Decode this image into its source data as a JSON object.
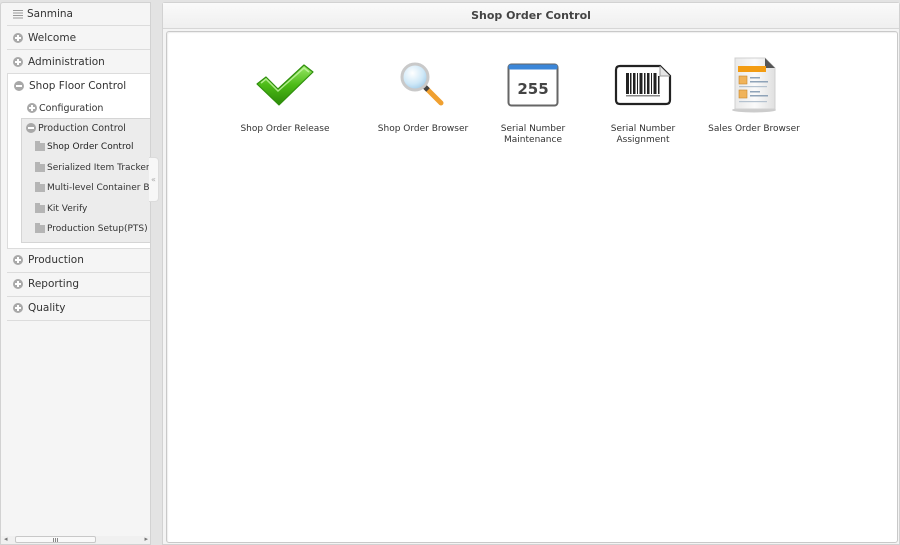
{
  "sidebar": {
    "header": "Sanmina",
    "items_top": [
      {
        "label": "Welcome",
        "icon": "plus-circle-icon"
      },
      {
        "label": "Administration",
        "icon": "plus-circle-icon"
      }
    ],
    "expanded": {
      "label": "Shop Floor Control",
      "icon": "minus-circle-icon",
      "children": [
        {
          "label": "Configuration",
          "icon": "plus-circle-icon"
        }
      ],
      "subgroup": {
        "label": "Production Control",
        "icon": "minus-circle-icon",
        "leaves": [
          {
            "label": "Shop Order Control",
            "active": true
          },
          {
            "label": "Serialized Item Tracker"
          },
          {
            "label": "Multi-level Container Browser"
          },
          {
            "label": "Kit Verify"
          },
          {
            "label": "Production Setup(PTS)"
          }
        ]
      }
    },
    "items_bottom": [
      {
        "label": "Production",
        "icon": "plus-circle-icon"
      },
      {
        "label": "Reporting",
        "icon": "plus-circle-icon"
      },
      {
        "label": "Quality",
        "icon": "plus-circle-icon"
      }
    ],
    "collapse_handle": "«"
  },
  "main": {
    "title": "Shop Order Control",
    "tiles": [
      {
        "label": "Shop Order Release",
        "icon": "green-checkmark-icon"
      },
      {
        "label": "Shop Order Browser",
        "icon": "magnifier-icon"
      },
      {
        "label": "Serial Number\nMaintenance",
        "line1": "Serial Number",
        "line2": "Maintenance",
        "icon": "number-counter-icon",
        "icon_text": "255"
      },
      {
        "label": "Serial Number\nAssignment",
        "line1": "Serial Number",
        "line2": "Assignment",
        "icon": "barcode-icon"
      },
      {
        "label": "Sales Order Browser",
        "icon": "document-list-icon"
      }
    ]
  },
  "colors": {
    "check_green": "#4cbb17",
    "magnifier_lens": "#cfe8f7",
    "magnifier_handle": "#f0a030",
    "counter_bar": "#3b86d8",
    "doc_orange": "#f39c12"
  }
}
